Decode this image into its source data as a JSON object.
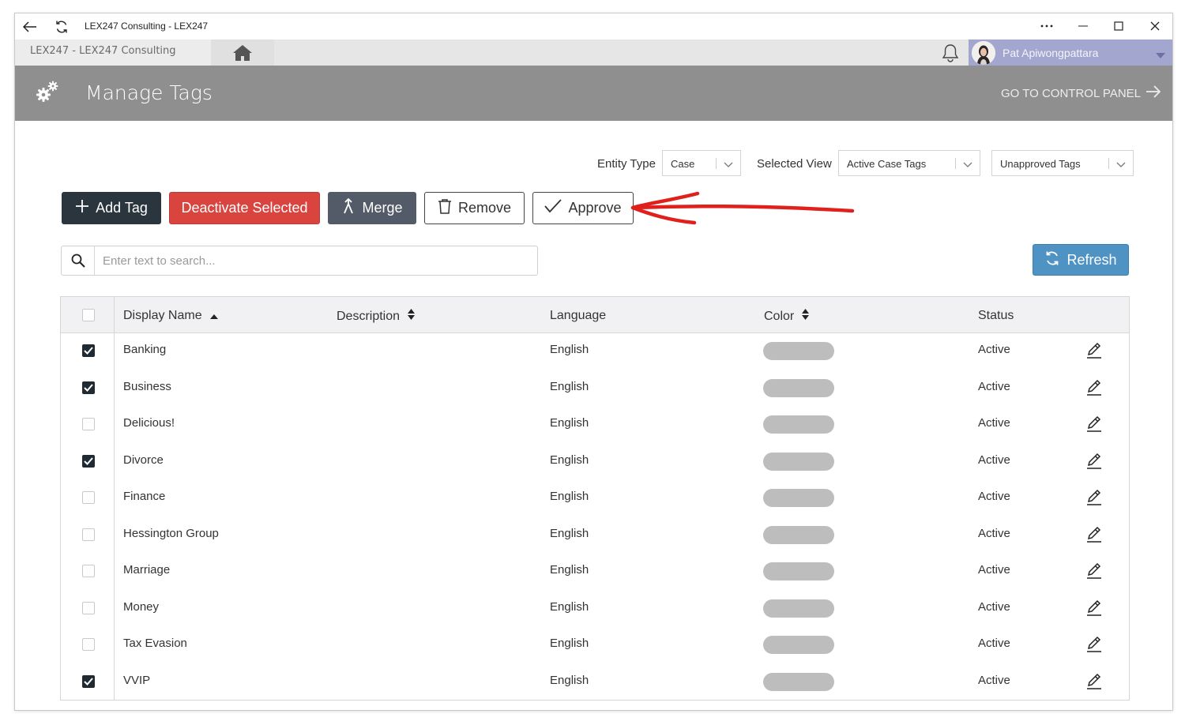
{
  "window": {
    "title": "LEX247 Consulting - LEX247"
  },
  "appbar": {
    "breadcrumb": "LEX247  -  LEX247 Consulting",
    "user_name": "Pat Apiwongpattara"
  },
  "header": {
    "page_title": "Manage Tags",
    "control_panel_link": "GO TO CONTROL PANEL"
  },
  "filters": {
    "entity_type_label": "Entity Type",
    "entity_type_value": "Case",
    "selected_view_label": "Selected View",
    "selected_view_value": "Active Case Tags",
    "approval_filter_value": "Unapproved Tags"
  },
  "actions": {
    "add_tag": "Add Tag",
    "deactivate_selected": "Deactivate Selected",
    "merge": "Merge",
    "remove": "Remove",
    "approve": "Approve",
    "refresh": "Refresh"
  },
  "search": {
    "placeholder": "Enter text to search..."
  },
  "table": {
    "columns": [
      "Display Name",
      "Description",
      "Language",
      "Color",
      "Status"
    ],
    "rows": [
      {
        "checked": true,
        "name": "Banking",
        "description": "",
        "language": "English",
        "status": "Active"
      },
      {
        "checked": true,
        "name": "Business",
        "description": "",
        "language": "English",
        "status": "Active"
      },
      {
        "checked": false,
        "name": "Delicious!",
        "description": "",
        "language": "English",
        "status": "Active"
      },
      {
        "checked": true,
        "name": "Divorce",
        "description": "",
        "language": "English",
        "status": "Active"
      },
      {
        "checked": false,
        "name": "Finance",
        "description": "",
        "language": "English",
        "status": "Active"
      },
      {
        "checked": false,
        "name": "Hessington Group",
        "description": "",
        "language": "English",
        "status": "Active"
      },
      {
        "checked": false,
        "name": "Marriage",
        "description": "",
        "language": "English",
        "status": "Active"
      },
      {
        "checked": false,
        "name": "Money",
        "description": "",
        "language": "English",
        "status": "Active"
      },
      {
        "checked": false,
        "name": "Tax Evasion",
        "description": "",
        "language": "English",
        "status": "Active"
      },
      {
        "checked": true,
        "name": "VVIP",
        "description": "",
        "language": "English",
        "status": "Active"
      }
    ]
  },
  "colors": {
    "header_band": "#8f8f8f",
    "user_badge": "#a3a6cf",
    "deactivate": "#d9443f",
    "refresh": "#4e93c4",
    "add_tag": "#2a353e",
    "annotation_arrow": "#e0201a",
    "tag_swatch": "#bdbdbd"
  },
  "icons": [
    "back-arrow-icon",
    "refresh-icon",
    "more-icon",
    "minimize-icon",
    "maximize-icon",
    "close-icon",
    "home-icon",
    "bell-icon",
    "chevron-down-icon",
    "gear-icon",
    "arrow-right-icon",
    "plus-icon",
    "merge-icon",
    "trash-icon",
    "check-icon",
    "search-icon",
    "sort-asc-icon",
    "sort-both-icon",
    "pencil-icon"
  ]
}
